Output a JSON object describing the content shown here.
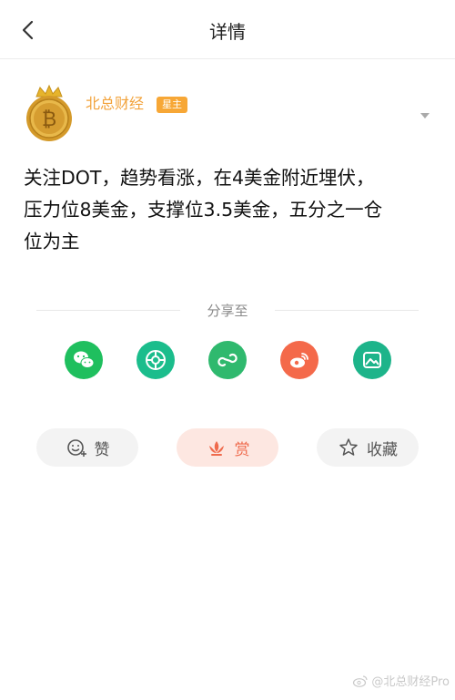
{
  "header": {
    "title": "详情"
  },
  "author": {
    "name": "北总财经",
    "badge": "星主"
  },
  "post": {
    "lines": [
      "关注DOT，趋势看涨，在4美金附近埋伏，",
      "压力位8美金，支撑位3.5美金，五分之一仓",
      "位为主"
    ]
  },
  "share": {
    "label": "分享至",
    "targets": [
      {
        "icon": "wechat-icon",
        "color": "#1fbf5e"
      },
      {
        "icon": "moments-icon",
        "color": "#1bbd8c"
      },
      {
        "icon": "mini-program-icon",
        "color": "#2fb96e"
      },
      {
        "icon": "weibo-icon",
        "color": "#f4694a"
      },
      {
        "icon": "image-icon",
        "color": "#1db48a"
      }
    ]
  },
  "actions": {
    "like": "赞",
    "reward": "赏",
    "favorite": "收藏"
  },
  "watermark": "@北总财经Pro",
  "colors": {
    "accent": "#f2a23a",
    "reward": "#ef6b4d"
  }
}
